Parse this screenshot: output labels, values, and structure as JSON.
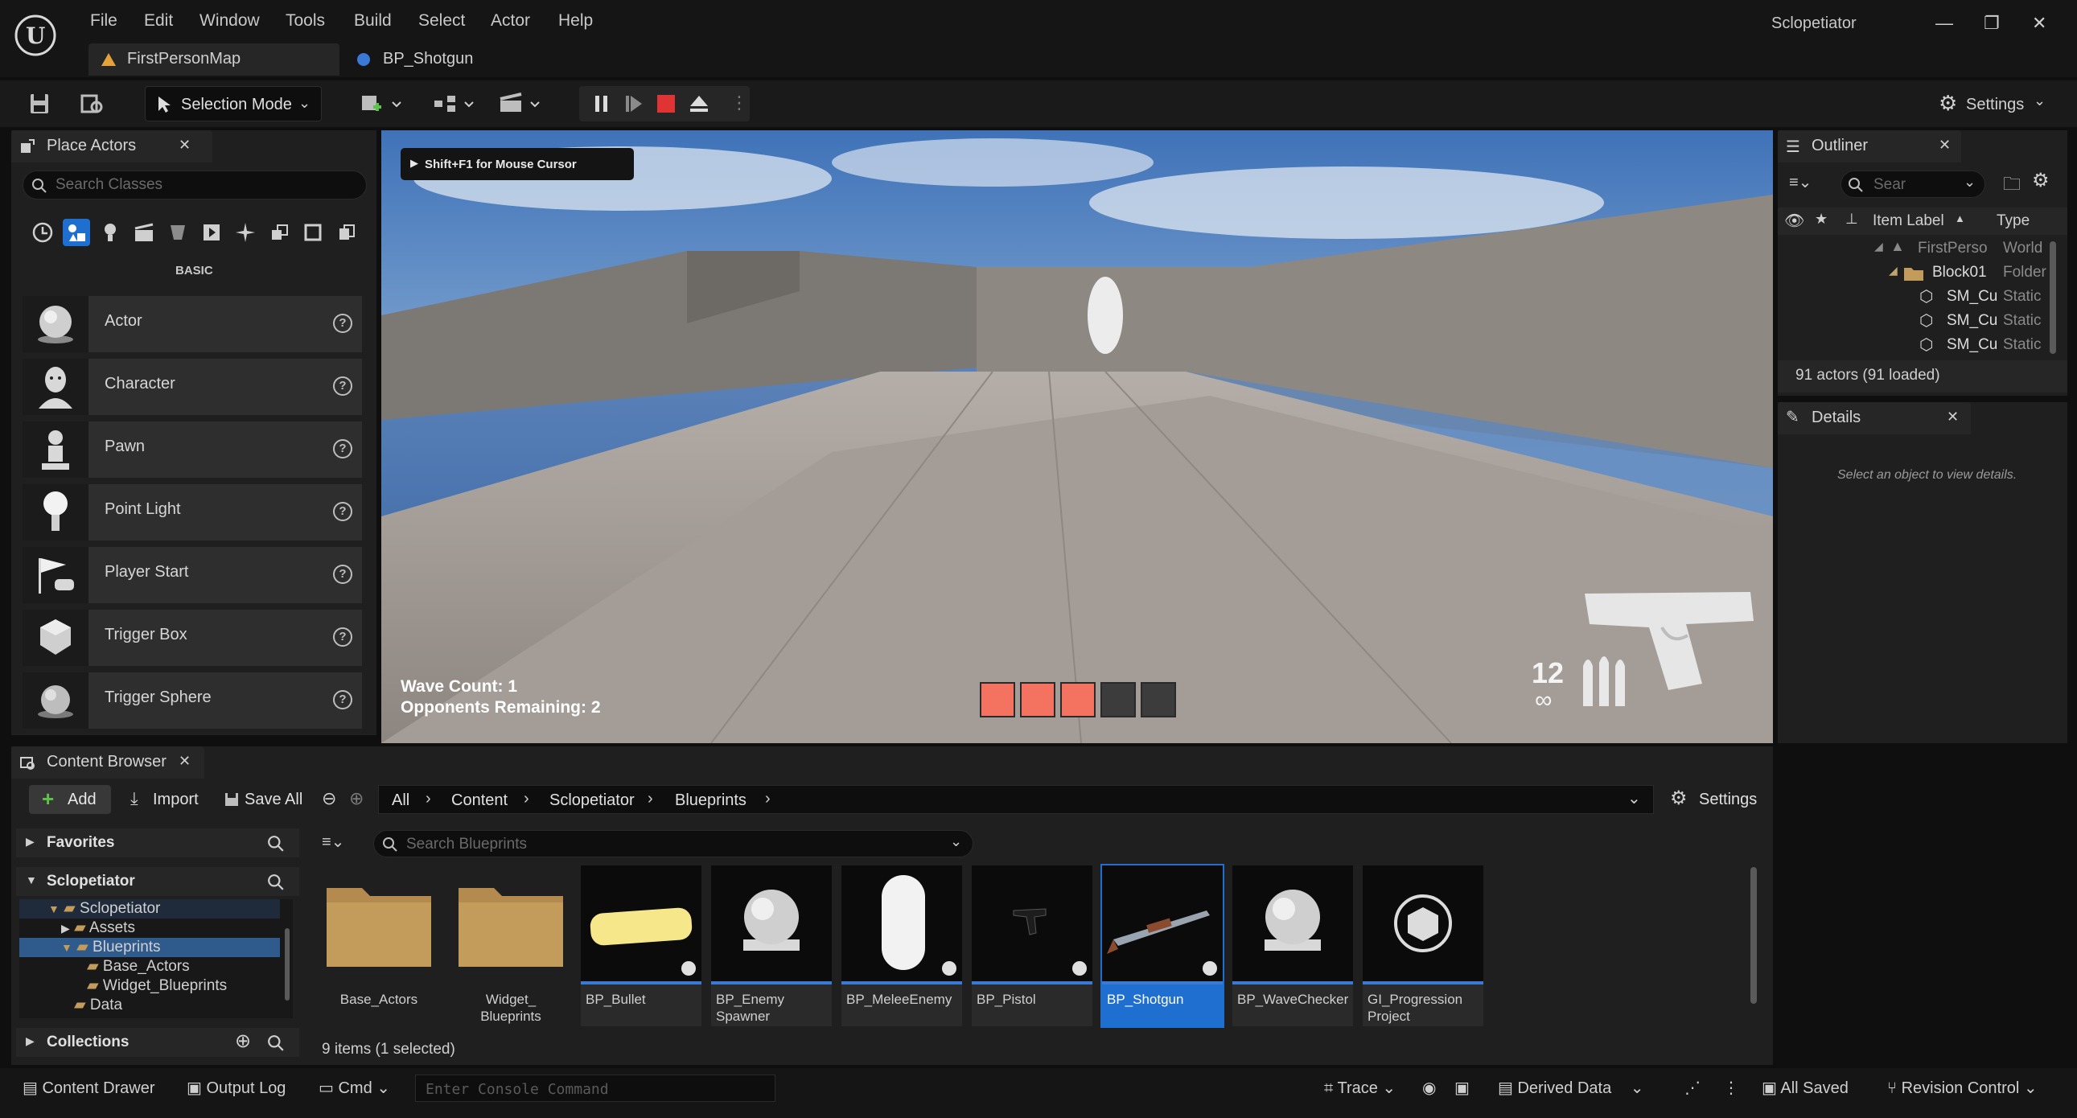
{
  "app": {
    "window_title": "Sclopetiator",
    "logo": "unreal-engine-logo",
    "menu": [
      "File",
      "Edit",
      "Window",
      "Tools",
      "Build",
      "Select",
      "Actor",
      "Help"
    ],
    "doc_tabs": [
      {
        "label": "FirstPersonMap",
        "icon": "map-icon",
        "active": true
      },
      {
        "label": "BP_Shotgun",
        "icon": "blueprint-icon",
        "active": false
      }
    ],
    "window_buttons": [
      "minimize",
      "restore",
      "close"
    ]
  },
  "toolbar": {
    "selection_mode": "Selection Mode",
    "settings": "Settings",
    "play_controls": [
      "pause",
      "skip-frame",
      "stop",
      "eject"
    ],
    "colors": {
      "stop": "#e03434"
    }
  },
  "place_actors": {
    "tab": "Place Actors",
    "search_placeholder": "Search Classes",
    "category_title": "BASIC",
    "categories": [
      "recent-icon",
      "basic-icon",
      "lights-icon",
      "cinematic-icon",
      "visual-effects-icon",
      "geometry-icon",
      "volumes-icon",
      "all-classes-icon",
      "shapes-icon",
      "more-icon"
    ],
    "items": [
      {
        "label": "Actor",
        "icon": "sphere-icon"
      },
      {
        "label": "Character",
        "icon": "character-icon"
      },
      {
        "label": "Pawn",
        "icon": "pawn-icon"
      },
      {
        "label": "Point Light",
        "icon": "light-bulb-icon"
      },
      {
        "label": "Player Start",
        "icon": "player-start-icon"
      },
      {
        "label": "Trigger Box",
        "icon": "trigger-box-icon"
      },
      {
        "label": "Trigger Sphere",
        "icon": "trigger-sphere-icon"
      }
    ]
  },
  "viewport": {
    "cursor_hint": "Shift+F1 for Mouse Cursor",
    "wave_count": "Wave Count: 1",
    "opponents_remaining": "Opponents Remaining: 2",
    "ammo": "12",
    "ammo_reserve": "∞",
    "health_cells_filled": 3,
    "health_cells_total": 5,
    "health_color": "#f47260"
  },
  "outliner": {
    "tab": "Outliner",
    "search_placeholder": "Sear",
    "col_label": "Item Label",
    "col_type": "Type",
    "rows": [
      {
        "label": "FirstPerso",
        "type": "World"
      },
      {
        "label": "Block01",
        "type": "Folder"
      },
      {
        "label": "SM_Cu",
        "type": "Static"
      },
      {
        "label": "SM_Cu",
        "type": "Static"
      },
      {
        "label": "SM_Cu",
        "type": "Static"
      }
    ],
    "summary": "91 actors (91 loaded)"
  },
  "details": {
    "tab": "Details",
    "empty_text": "Select an object to view details."
  },
  "content_browser": {
    "tab": "Content Browser",
    "add": "Add",
    "import": "Import",
    "save_all": "Save All",
    "settings": "Settings",
    "path": [
      "All",
      "Content",
      "Sclopetiator",
      "Blueprints"
    ],
    "search_placeholder": "Search Blueprints",
    "favorites": "Favorites",
    "project_root": "Sclopetiator",
    "collections": "Collections",
    "tree": [
      "Sclopetiator",
      "Assets",
      "Blueprints",
      "Base_Actors",
      "Widget_Blueprints",
      "Data"
    ],
    "assets": [
      {
        "label": "Base_Actors",
        "kind": "folder"
      },
      {
        "label": "Widget_ Blueprints",
        "kind": "folder"
      },
      {
        "label": "BP_Bullet",
        "kind": "blueprint"
      },
      {
        "label": "BP_Enemy Spawner",
        "kind": "blueprint"
      },
      {
        "label": "BP_MeleeEnemy",
        "kind": "blueprint"
      },
      {
        "label": "BP_Pistol",
        "kind": "blueprint"
      },
      {
        "label": "BP_Shotgun",
        "kind": "blueprint",
        "selected": true
      },
      {
        "label": "BP_WaveChecker",
        "kind": "blueprint"
      },
      {
        "label": "GI_Progression Project",
        "kind": "game-instance"
      }
    ],
    "item_count": "9 items (1 selected)",
    "selection_color": "#1f6fd1"
  },
  "statusbar": {
    "content_drawer": "Content Drawer",
    "output_log": "Output Log",
    "cmd": "Cmd",
    "console_placeholder": "Enter Console Command",
    "trace": "Trace",
    "derived_data": "Derived Data",
    "all_saved": "All Saved",
    "revision_control": "Revision Control"
  }
}
